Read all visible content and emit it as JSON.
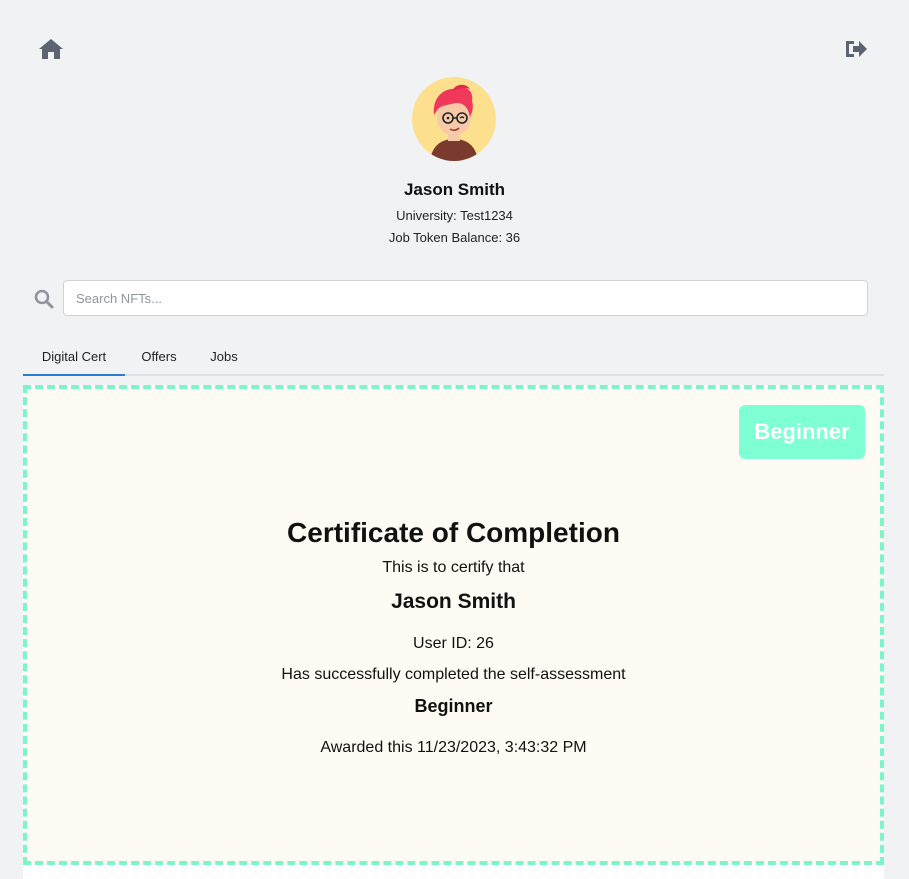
{
  "profile": {
    "name": "Jason Smith",
    "university": "University: Test1234",
    "token_balance": "Job Token Balance: 36"
  },
  "search": {
    "placeholder": "Search NFTs..."
  },
  "tabs": [
    {
      "label": "Digital Cert",
      "active": true
    },
    {
      "label": "Offers",
      "active": false
    },
    {
      "label": "Jobs",
      "active": false
    }
  ],
  "certificate": {
    "badge": "Beginner",
    "title": "Certificate of Completion",
    "intro": "This is to certify that",
    "recipient": "Jason Smith",
    "user_id": "User ID: 26",
    "completed_text": "Has successfully completed the self-assessment",
    "level": "Beginner",
    "awarded": "Awarded this 11/23/2023, 3:43:32 PM"
  },
  "icons": {
    "home": "home-icon",
    "logout": "logout-icon",
    "search": "search-icon"
  },
  "colors": {
    "accent_tab": "#2b7bd6",
    "badge_bg": "#7fffd4",
    "cert_border": "#7cf5cc",
    "cert_bg": "#fdfbf3",
    "icon": "#5b6470"
  }
}
